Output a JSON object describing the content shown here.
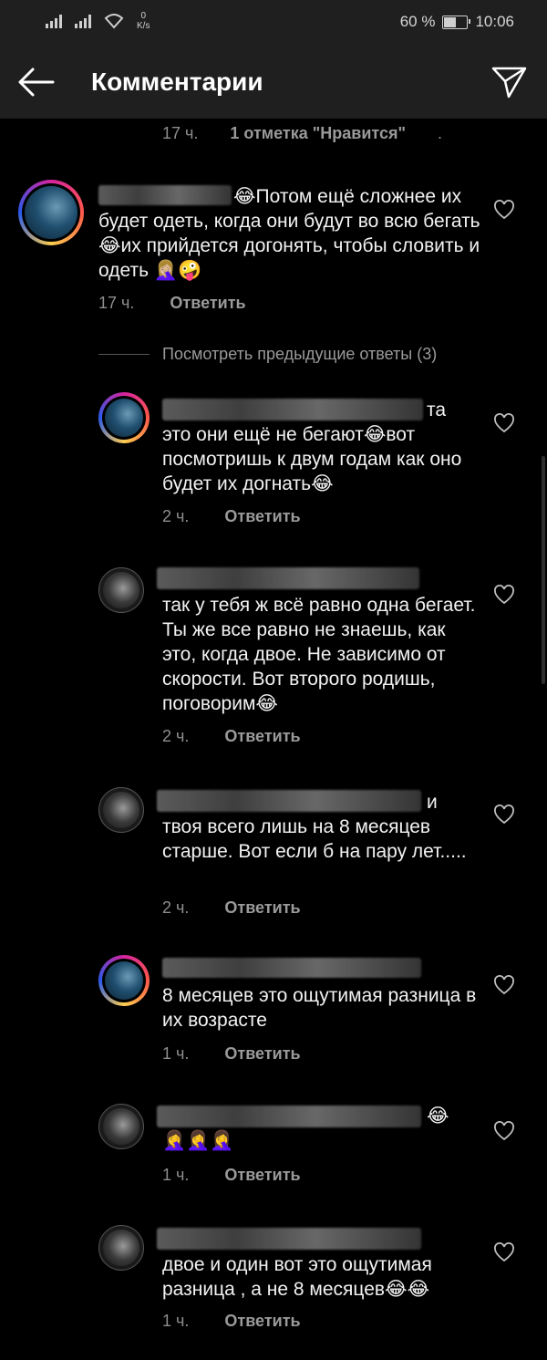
{
  "status": {
    "speed_value": "0",
    "speed_unit": "K/s",
    "battery": "60 %",
    "time": "10:06",
    "battery_level": 0.6
  },
  "header": {
    "title": "Комментарии"
  },
  "top_meta": {
    "time": "17 ч.",
    "likes": "1 отметка \"Нравится\"",
    "dot": "."
  },
  "main_comment": {
    "text": "😂Потом ещё сложнее их будет одеть, когда они будут во всю бегать😂их прийдется догонять, чтобы словить и одеть 🤦🏼‍♀️🤪",
    "time": "17 ч.",
    "reply_label": "Ответить"
  },
  "view_previous": "Посмотреть предыдущие ответы (3)",
  "replies": [
    {
      "text": "та это они ещё не бегают😂вот посмотришь к двум годам как оно будет их догнать😂",
      "time": "2 ч.",
      "reply_label": "Ответить"
    },
    {
      "text": "так у тебя ж всё равно одна бегает. Ты же все равно не знаешь, как это, когда двое. Не зависимо от скорости. Вот второго родишь, поговорим😂",
      "time": "2 ч.",
      "reply_label": "Ответить"
    },
    {
      "text": "и твоя всего лишь на 8 месяцев старше. Вот если б на пару лет.....",
      "time": "2 ч.",
      "reply_label": "Ответить"
    },
    {
      "text": "8 месяцев это ощутимая разница в их возрасте",
      "time": "1 ч.",
      "reply_label": "Ответить"
    },
    {
      "text": "😂 🤦‍♀️🤦‍♀️🤦‍♀️",
      "time": "1 ч.",
      "reply_label": "Ответить"
    },
    {
      "text": "двое и один вот это ощутимая разница , а не 8 месяцев😂😂",
      "time": "1 ч.",
      "reply_label": "Ответить"
    }
  ],
  "icons": {
    "back": "back-arrow-icon",
    "send": "send-icon",
    "like": "heart-outline-icon"
  }
}
